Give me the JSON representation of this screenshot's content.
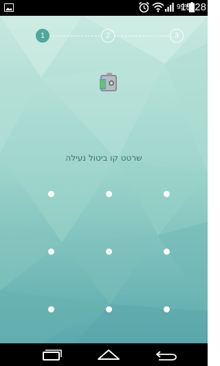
{
  "status_bar": {
    "notification_icon": "picture-icon",
    "alarm_icon": "alarm-clock-icon",
    "wifi_icon": "wifi-icon",
    "signal_icon": "signal-icon",
    "battery_percent": "99%",
    "battery_icon": "battery-icon",
    "time": "15:28"
  },
  "stepper": {
    "steps": [
      {
        "label": "1",
        "state": "active"
      },
      {
        "label": "2",
        "state": "inactive"
      },
      {
        "label": "3",
        "state": "inactive"
      }
    ]
  },
  "app_icon": "vault-lock-icon",
  "instruction": "שרטט קו ביטול נעילה",
  "pattern": {
    "rows": 3,
    "cols": 3
  },
  "nav_bar": {
    "recent_icon": "recent-apps-icon",
    "home_icon": "home-icon",
    "back_icon": "back-icon"
  },
  "colors": {
    "active_step": "#4fa89b",
    "background_top": "#bfe5dc",
    "background_bottom": "#5fb1b4",
    "instruction_text": "#3e6e6a"
  }
}
